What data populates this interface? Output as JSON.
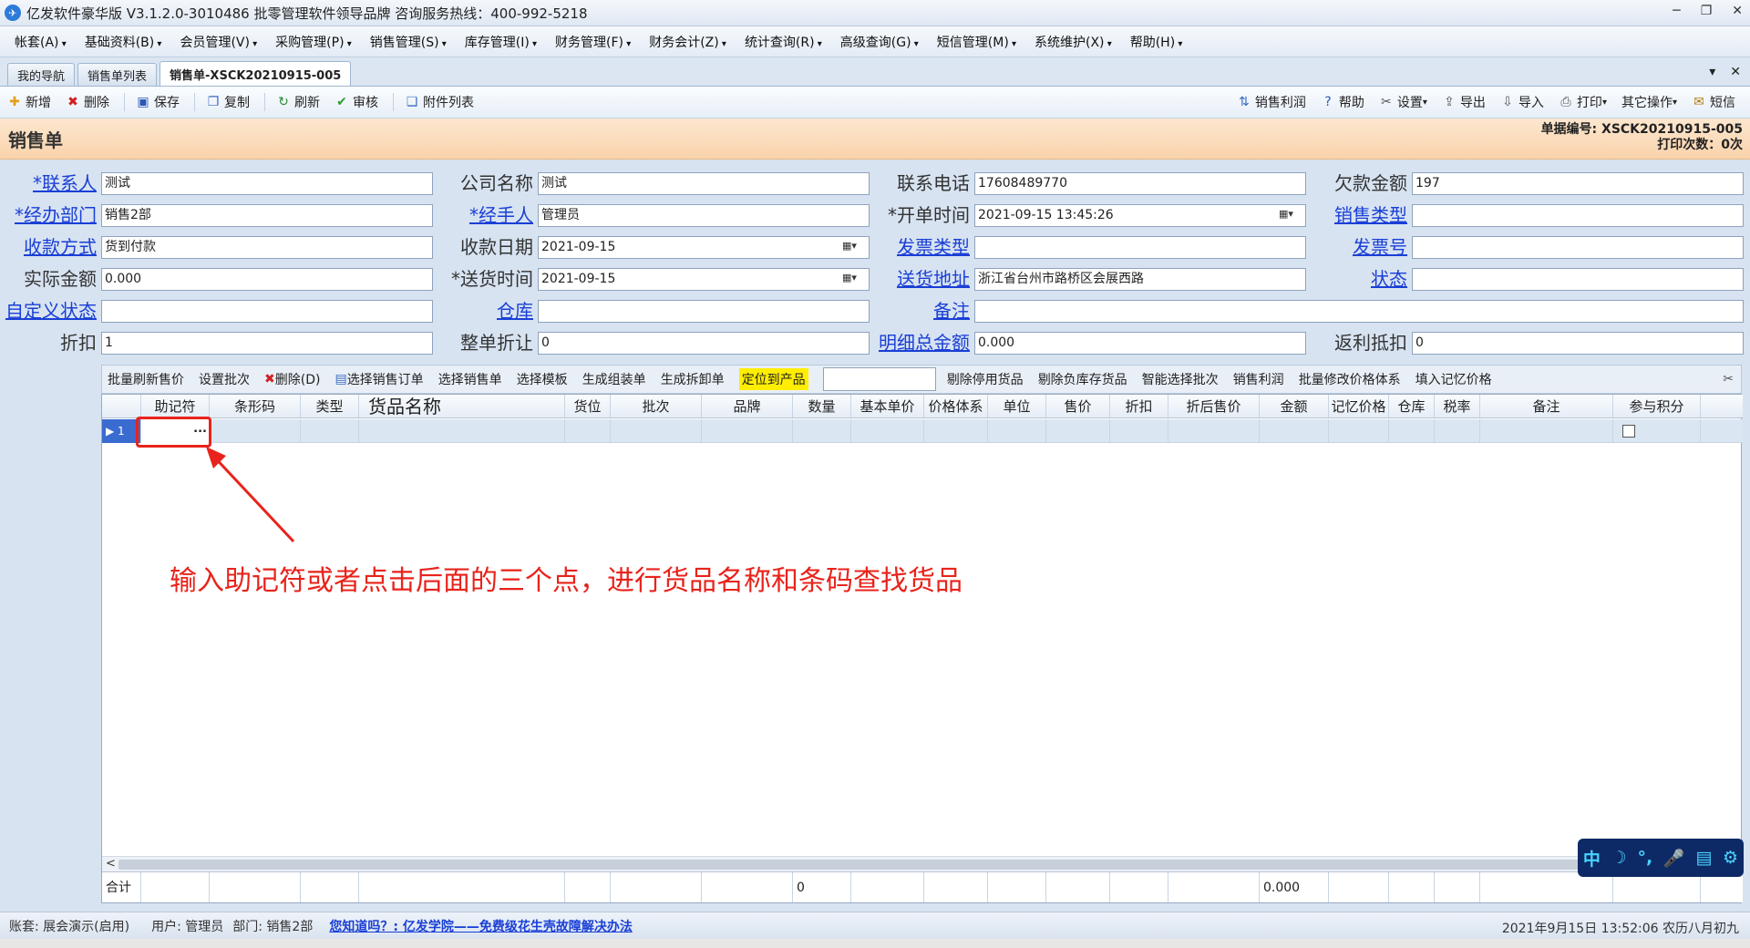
{
  "window": {
    "title": "亿发软件豪华版 V3.1.2.0-3010486 批零管理软件领导品牌 咨询服务热线：400-992-5218",
    "controls": [
      "─",
      "❐",
      "✕"
    ]
  },
  "menu": [
    "帐套(A)",
    "基础资料(B)",
    "会员管理(V)",
    "采购管理(P)",
    "销售管理(S)",
    "库存管理(I)",
    "财务管理(F)",
    "财务会计(Z)",
    "统计查询(R)",
    "高级查询(G)",
    "短信管理(M)",
    "系统维护(X)",
    "帮助(H)"
  ],
  "tabs": [
    "我的导航",
    "销售单列表",
    "销售单-XSCK20210915-005"
  ],
  "toolbar_left": [
    {
      "label": "新增",
      "icon": "add-icon",
      "glyph": "✚",
      "color": "#e0a020"
    },
    {
      "label": "删除",
      "icon": "delete-icon",
      "glyph": "✖",
      "color": "#d02020"
    },
    {
      "label": "保存",
      "icon": "save-icon",
      "glyph": "▣",
      "color": "#2a56b8"
    },
    {
      "label": "复制",
      "icon": "copy-icon",
      "glyph": "❐",
      "color": "#3a6bbf"
    },
    {
      "label": "刷新",
      "icon": "refresh-icon",
      "glyph": "↻",
      "color": "#2a8a3a"
    },
    {
      "label": "审核",
      "icon": "check-icon",
      "glyph": "✔",
      "color": "#2aa030"
    },
    {
      "label": "附件列表",
      "icon": "attachment-icon",
      "glyph": "❏",
      "color": "#3a6bbf"
    }
  ],
  "toolbar_right": [
    {
      "label": "销售利润",
      "icon": "profit-icon",
      "glyph": "⇅",
      "color": "#3a6bbf"
    },
    {
      "label": "帮助",
      "icon": "help-icon",
      "glyph": "?",
      "color": "#2a56b8"
    },
    {
      "label": "设置",
      "icon": "settings-icon",
      "glyph": "✂",
      "color": "#555",
      "dropdown": true
    },
    {
      "label": "导出",
      "icon": "export-icon",
      "glyph": "⇪",
      "color": "#555"
    },
    {
      "label": "导入",
      "icon": "import-icon",
      "glyph": "⇩",
      "color": "#555"
    },
    {
      "label": "打印",
      "icon": "print-icon",
      "glyph": "⎙",
      "color": "#555",
      "dropdown": true
    },
    {
      "label": "其它操作",
      "icon": "",
      "glyph": "",
      "color": "#555",
      "dropdown": true
    },
    {
      "label": "短信",
      "icon": "sms-icon",
      "glyph": "✉",
      "color": "#b07a10"
    }
  ],
  "header": {
    "title": "销售单",
    "doc_no": "单据编号: XSCK20210915-005",
    "print_count": "打印次数：0次"
  },
  "form": {
    "contact": {
      "label": "*联系人",
      "value": "测试"
    },
    "company": {
      "label": "公司名称",
      "value": "测试"
    },
    "phone": {
      "label": "联系电话",
      "value": "17608489770"
    },
    "debt": {
      "label": "欠款金额",
      "value": "197"
    },
    "dept": {
      "label": "*经办部门",
      "value": "销售2部"
    },
    "handler": {
      "label": "*经手人",
      "value": "管理员"
    },
    "open_time": {
      "label": "*开单时间",
      "value": "2021-09-15 13:45:26"
    },
    "sale_type": {
      "label": "销售类型",
      "value": ""
    },
    "pay_method": {
      "label": "收款方式",
      "value": "货到付款"
    },
    "pay_date": {
      "label": "收款日期",
      "value": "2021-09-15"
    },
    "invoice_type": {
      "label": "发票类型",
      "value": ""
    },
    "invoice_no": {
      "label": "发票号",
      "value": ""
    },
    "actual_amount": {
      "label": "实际金额",
      "value": "0.000"
    },
    "delivery_time": {
      "label": "*送货时间",
      "value": "2021-09-15"
    },
    "delivery_addr": {
      "label": "送货地址",
      "value": "浙江省台州市路桥区会展西路"
    },
    "status": {
      "label": "状态",
      "value": ""
    },
    "custom_status": {
      "label": "自定义状态",
      "value": ""
    },
    "warehouse": {
      "label": "仓库",
      "value": ""
    },
    "remark": {
      "label": "备注",
      "value": ""
    },
    "discount": {
      "label": "折扣",
      "value": "1"
    },
    "whole_discount": {
      "label": "整单折让",
      "value": "0"
    },
    "detail_total": {
      "label": "明细总金额",
      "value": "0.000"
    },
    "rebate": {
      "label": "返利抵扣",
      "value": "0"
    }
  },
  "grid_toolbar": [
    "批量刷新售价",
    "设置批次",
    "删除(D)",
    "选择销售订单",
    "选择销售单",
    "选择模板",
    "生成组装单",
    "生成拆卸单",
    "定位到产品",
    "剔除停用货品",
    "剔除负库存货品",
    "智能选择批次",
    "销售利润",
    "批量修改价格体系",
    "填入记忆价格"
  ],
  "grid": {
    "columns": [
      "",
      "助记符",
      "条形码",
      "类型",
      "货品名称",
      "货位",
      "批次",
      "品牌",
      "数量",
      "基本单价",
      "价格体系",
      "单位",
      "售价",
      "折扣",
      "折后售价",
      "金额",
      "记忆价格",
      "仓库",
      "税率",
      "备注",
      "参与积分"
    ],
    "row_index": "1",
    "ellipsis": "...",
    "sum_label": "合计",
    "sum_qty": "0",
    "sum_amount": "0.000"
  },
  "annotation": "输入助记符或者点击后面的三个点，进行货品名称和条码查找货品",
  "status": {
    "account": "账套: 展会演示(启用)",
    "user": "用户: 管理员",
    "dept": "部门: 销售2部",
    "tip": "您知道吗？: 亿发学院——免费级花生壳故障解决办法",
    "datetime": "2021年9月15日 13:52:06 农历八月初九"
  },
  "ime_icons": [
    "中",
    "☽",
    "°,",
    "🎤",
    "▤",
    "⚙"
  ],
  "colors": {
    "link": "#1a3fd6",
    "annotation": "#e8231b",
    "header_bg": "#f9d3ab",
    "highlight": "#ffee00"
  }
}
